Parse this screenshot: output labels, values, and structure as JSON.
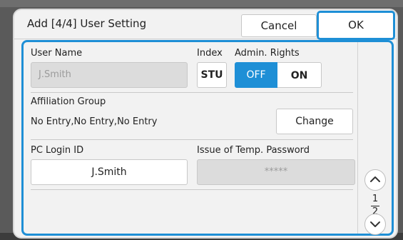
{
  "dialog": {
    "title": "Add [4/4] User Setting",
    "cancel_label": "Cancel",
    "ok_label": "OK"
  },
  "form": {
    "user_name": {
      "label": "User Name",
      "value": "J.Smith"
    },
    "index": {
      "label": "Index",
      "value": "STU"
    },
    "admin_rights": {
      "label": "Admin. Rights",
      "off_label": "OFF",
      "on_label": "ON",
      "selected": "OFF"
    },
    "affiliation_group": {
      "label": "Affiliation Group",
      "value": "No Entry,No Entry,No Entry",
      "change_label": "Change"
    },
    "pc_login_id": {
      "label": "PC Login ID",
      "value": "J.Smith"
    },
    "temp_password": {
      "label": "Issue of Temp. Password",
      "value": "*****"
    }
  },
  "pager": {
    "current": "1",
    "total": "2",
    "up_icon": "chevron-up-icon",
    "down_icon": "chevron-down-icon"
  },
  "colors": {
    "accent": "#1e8fd6",
    "panel": "#f2f2f2",
    "disabled_field": "#dcdcdc"
  }
}
